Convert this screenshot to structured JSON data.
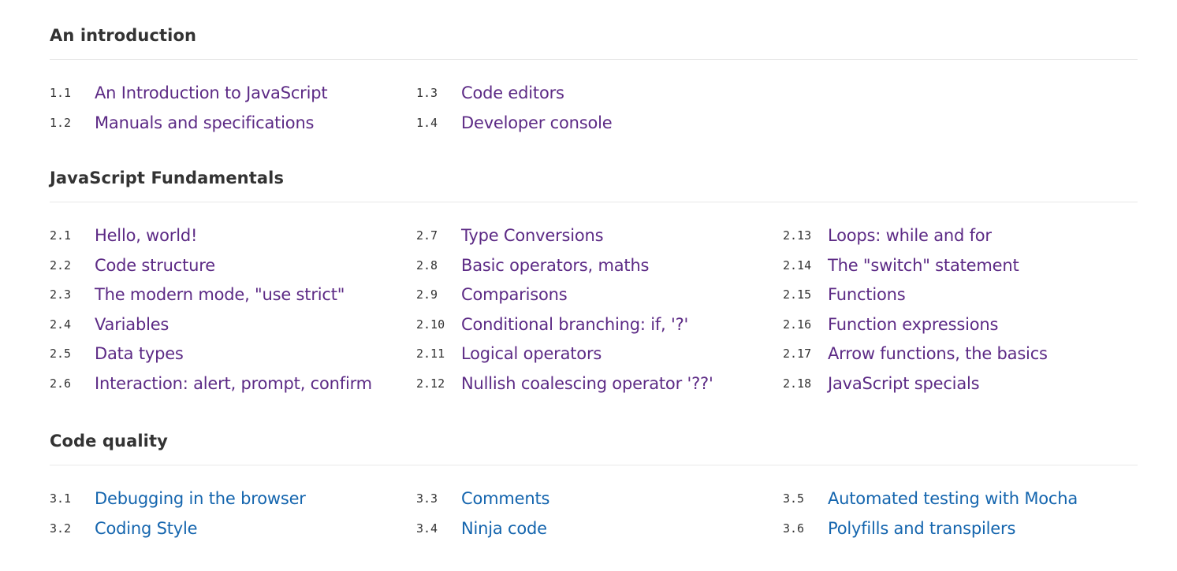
{
  "colors": {
    "heading": "#333333",
    "number": "#333333",
    "visited_link": "#5c2a85",
    "unvisited_link": "#1465ae",
    "divider": "#e8e8e8"
  },
  "sections": [
    {
      "title": "An introduction",
      "columns": [
        [
          {
            "num": "1.1",
            "label": "An Introduction to JavaScript"
          },
          {
            "num": "1.2",
            "label": "Manuals and specifications"
          }
        ],
        [
          {
            "num": "1.3",
            "label": "Code editors"
          },
          {
            "num": "1.4",
            "label": "Developer console"
          }
        ]
      ]
    },
    {
      "title": "JavaScript Fundamentals",
      "columns": [
        [
          {
            "num": "2.1",
            "label": "Hello, world!"
          },
          {
            "num": "2.2",
            "label": "Code structure"
          },
          {
            "num": "2.3",
            "label": "The modern mode, \"use strict\""
          },
          {
            "num": "2.4",
            "label": "Variables"
          },
          {
            "num": "2.5",
            "label": "Data types"
          },
          {
            "num": "2.6",
            "label": "Interaction: alert, prompt, confirm"
          }
        ],
        [
          {
            "num": "2.7",
            "label": "Type Conversions"
          },
          {
            "num": "2.8",
            "label": "Basic operators, maths"
          },
          {
            "num": "2.9",
            "label": "Comparisons"
          },
          {
            "num": "2.10",
            "label": "Conditional branching: if, '?'"
          },
          {
            "num": "2.11",
            "label": "Logical operators"
          },
          {
            "num": "2.12",
            "label": "Nullish coalescing operator '??'"
          }
        ],
        [
          {
            "num": "2.13",
            "label": "Loops: while and for"
          },
          {
            "num": "2.14",
            "label": "The \"switch\" statement"
          },
          {
            "num": "2.15",
            "label": "Functions"
          },
          {
            "num": "2.16",
            "label": "Function expressions"
          },
          {
            "num": "2.17",
            "label": "Arrow functions, the basics"
          },
          {
            "num": "2.18",
            "label": "JavaScript specials"
          }
        ]
      ]
    },
    {
      "title": "Code quality",
      "columns": [
        [
          {
            "num": "3.1",
            "label": "Debugging in the browser"
          },
          {
            "num": "3.2",
            "label": "Coding Style"
          }
        ],
        [
          {
            "num": "3.3",
            "label": "Comments"
          },
          {
            "num": "3.4",
            "label": "Ninja code"
          }
        ],
        [
          {
            "num": "3.5",
            "label": "Automated testing with Mocha"
          },
          {
            "num": "3.6",
            "label": "Polyfills and transpilers"
          }
        ]
      ]
    }
  ]
}
